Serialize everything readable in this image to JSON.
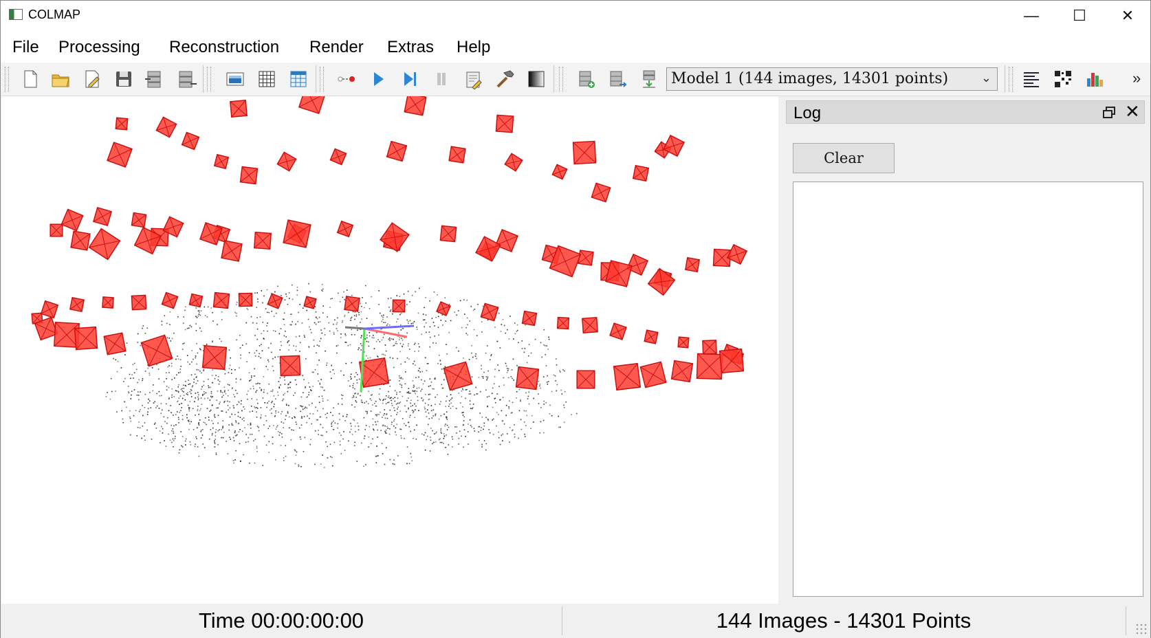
{
  "window": {
    "title": "COLMAP",
    "minimize_glyph": "—",
    "maximize_glyph": "☐",
    "close_glyph": "✕"
  },
  "menu": [
    "File",
    "Processing",
    "Reconstruction",
    "Render",
    "Extras",
    "Help"
  ],
  "toolbar": {
    "groups": [
      [
        "new-project-icon",
        "open-project-icon",
        "edit-project-icon",
        "save-project-icon",
        "import-model-icon",
        "export-model-icon"
      ],
      [
        "feature-extraction-icon",
        "feature-matching-icon",
        "database-management-icon"
      ],
      [
        "automatic-reconstruction-icon",
        "start-reconstruction-icon",
        "step-reconstruction-icon",
        "pause-reconstruction-icon",
        "reconstruction-options-icon",
        "bundle-adjustment-icon",
        "dense-reconstruction-icon"
      ],
      [
        "grab-image-icon",
        "grab-movie-icon",
        "render-toggle-icon"
      ],
      [
        "show-log-icon",
        "match-matrix-icon",
        "model-stats-icon"
      ]
    ],
    "model_selector": "Model 1 (144 images, 14301 points)",
    "overflow_glyph": "»"
  },
  "log": {
    "title": "Log",
    "clear_label": "Clear",
    "content": ""
  },
  "status": {
    "time": "Time 00:00:00:00",
    "counts": "144 Images - 14301 Points"
  },
  "scene": {
    "camera_color": "#ff3b2f",
    "camera_edge_color": "#cc1111",
    "axis_colors": {
      "x": "#ff6a6a",
      "y": "#55dd55",
      "z": "#6b6bff"
    },
    "point_color": "#333333",
    "reconstructed_images": 144,
    "reconstructed_points": 14301
  }
}
